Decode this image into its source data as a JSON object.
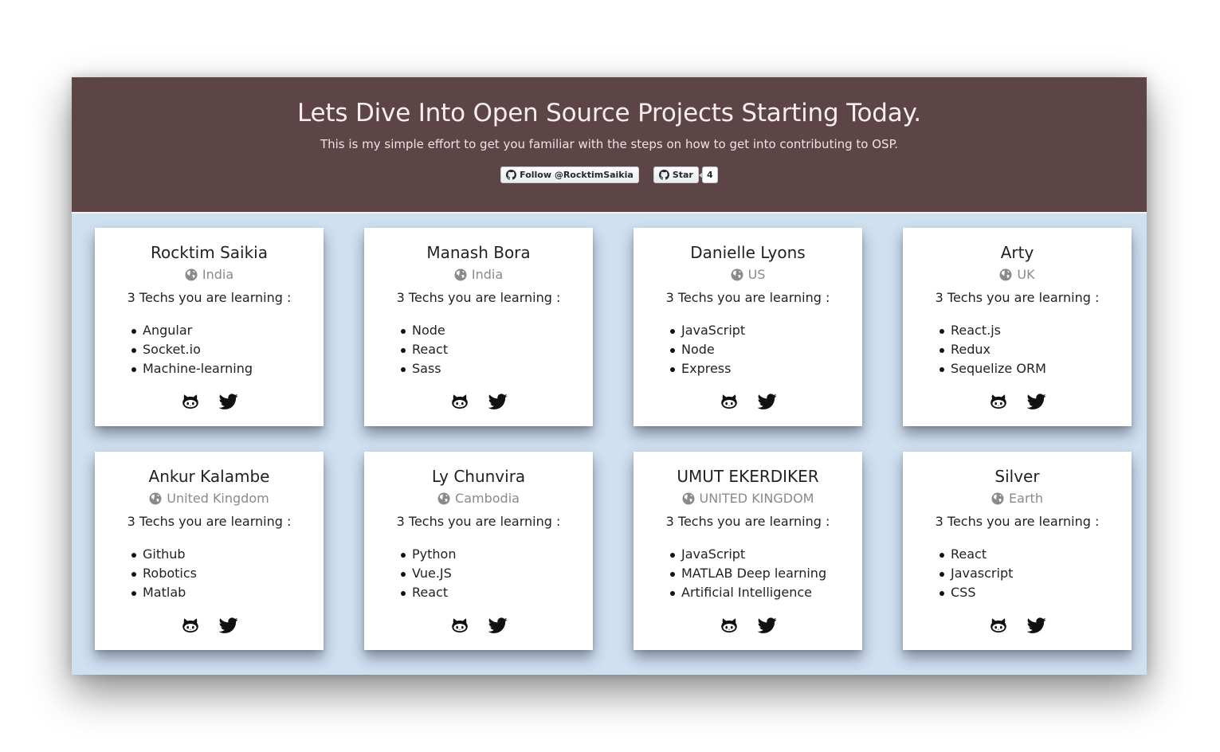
{
  "header": {
    "title": "Lets Dive Into Open Source Projects Starting Today.",
    "subtitle": "This is my simple effort to get you familiar with the steps on how to get into contributing to OSP.",
    "follow_label": "Follow @RocktimSaikia",
    "star_label": "Star",
    "star_count": "4",
    "background_color": "#5d4446"
  },
  "learning_label": "3 Techs you are learning :",
  "cards": [
    {
      "name": "Rocktim Saikia",
      "country": "India",
      "techs": [
        "Angular",
        "Socket.io",
        "Machine-learning"
      ]
    },
    {
      "name": "Manash Bora",
      "country": "India",
      "techs": [
        "Node",
        "React",
        "Sass"
      ]
    },
    {
      "name": "Danielle Lyons",
      "country": "US",
      "techs": [
        "JavaScript",
        "Node",
        "Express"
      ]
    },
    {
      "name": "Arty",
      "country": "UK",
      "techs": [
        "React.js",
        "Redux",
        "Sequelize ORM"
      ]
    },
    {
      "name": "Ankur Kalambe",
      "country": "United Kingdom",
      "techs": [
        "Github",
        "Robotics",
        "Matlab"
      ]
    },
    {
      "name": "Ly Chunvira",
      "country": "Cambodia",
      "techs": [
        "Python",
        "Vue.JS",
        "React"
      ]
    },
    {
      "name": "UMUT EKERDIKER",
      "country": "UNITED KINGDOM",
      "techs": [
        "JavaScript",
        "MATLAB Deep learning",
        "Artificial Intelligence"
      ]
    },
    {
      "name": "Silver",
      "country": "Earth",
      "techs": [
        "React",
        "Javascript",
        "CSS"
      ]
    }
  ],
  "icons": {
    "globe": "globe-icon",
    "github": "github-icon",
    "twitter": "twitter-icon"
  },
  "colors": {
    "page_background": "#cfe0f1",
    "card": "#ffffff"
  }
}
